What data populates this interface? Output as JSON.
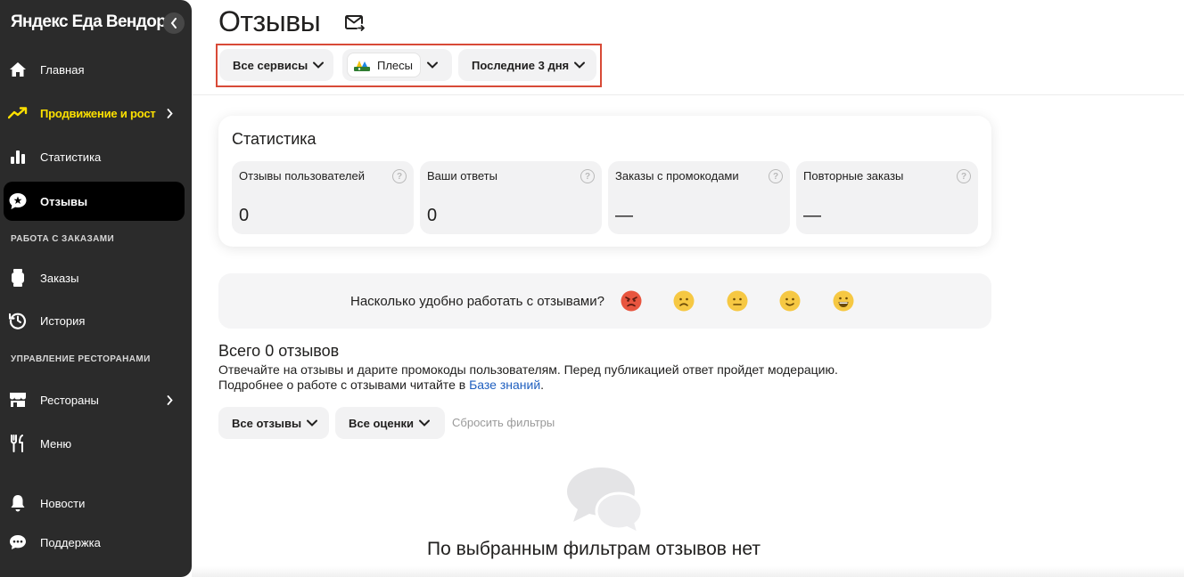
{
  "sidebar": {
    "brand": "Яндекс Еда Вендор",
    "nav": {
      "home": "Главная",
      "promo": "Продвижение и рост",
      "stats": "Статистика",
      "reviews": "Отзывы",
      "orders": "Заказы",
      "history": "История",
      "restaurants": "Рестораны",
      "menu": "Меню",
      "news": "Новости",
      "support": "Поддержка"
    },
    "sections": {
      "orders_work": "РАБОТА С ЗАКАЗАМИ",
      "restaurant_mgmt": "УПРАВЛЕНИЕ РЕСТОРАНАМИ"
    }
  },
  "header": {
    "title": "Отзывы",
    "filters": {
      "services": "Все сервисы",
      "restaurant": "Плесы",
      "period": "Последние 3 дня"
    }
  },
  "stats": {
    "title": "Статистика",
    "tiles": [
      {
        "label": "Отзывы пользователей",
        "value": "0"
      },
      {
        "label": "Ваши ответы",
        "value": "0"
      },
      {
        "label": "Заказы с промокодами",
        "value": "—"
      },
      {
        "label": "Повторные заказы",
        "value": "—"
      }
    ],
    "help_glyph": "?"
  },
  "survey": {
    "question": "Насколько удобно работать с отзывами?",
    "options": [
      "angry-face-icon",
      "frowning-face-icon",
      "neutral-face-icon",
      "slightly-smiling-face-icon",
      "grinning-face-icon"
    ]
  },
  "reviews": {
    "title": "Всего 0 отзывов",
    "desc1": "Отвечайте на отзывы и дарите промокоды пользователям. Перед публикацией ответ пройдет модерацию.",
    "desc2_prefix": "Подробнее о работе с отзывами читайте в ",
    "desc2_link": "Базе знаний",
    "desc2_suffix": ".",
    "filter_all": "Все отзывы",
    "filter_ratings": "Все оценки",
    "reset": "Сбросить фильтры",
    "empty": "По выбранным фильтрам отзывов нет"
  },
  "colors": {
    "sidebar_bg": "#2b2b2b",
    "accent_yellow": "#fce000",
    "highlight_red": "#d84a37",
    "link_blue": "#1f5fbf"
  }
}
